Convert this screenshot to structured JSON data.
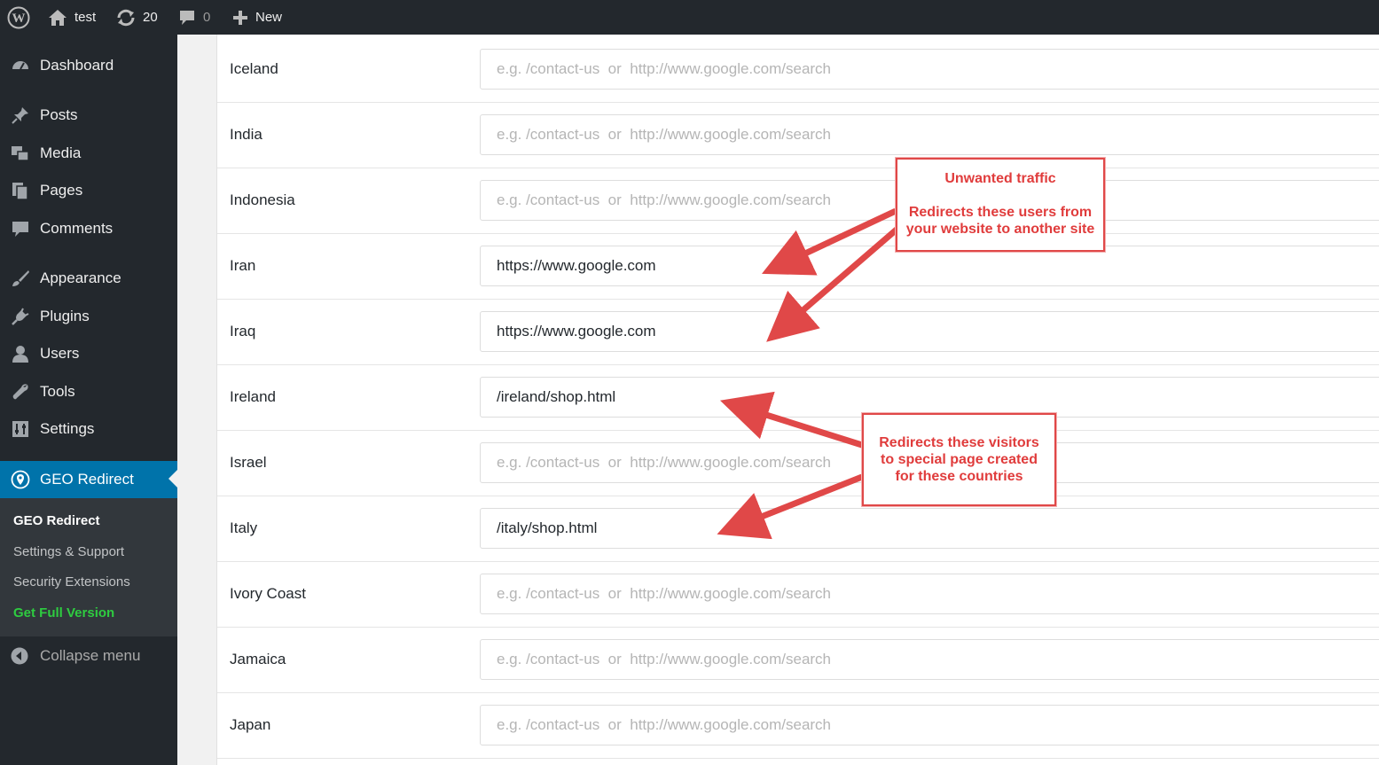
{
  "adminbar": {
    "site_name": "test",
    "updates_count": "20",
    "comments_count": "0",
    "new_label": "New"
  },
  "sidebar": {
    "items": [
      {
        "label": "Dashboard",
        "icon": "dashboard-icon"
      },
      {
        "label": "Posts",
        "icon": "pin-icon"
      },
      {
        "label": "Media",
        "icon": "media-icon"
      },
      {
        "label": "Pages",
        "icon": "pages-icon"
      },
      {
        "label": "Comments",
        "icon": "comment-icon"
      },
      {
        "label": "Appearance",
        "icon": "brush-icon"
      },
      {
        "label": "Plugins",
        "icon": "plug-icon"
      },
      {
        "label": "Users",
        "icon": "user-icon"
      },
      {
        "label": "Tools",
        "icon": "wrench-icon"
      },
      {
        "label": "Settings",
        "icon": "settings-icon"
      },
      {
        "label": "GEO Redirect",
        "icon": "location-pin-icon"
      }
    ],
    "submenu": [
      {
        "label": "GEO Redirect"
      },
      {
        "label": "Settings & Support"
      },
      {
        "label": "Security Extensions"
      },
      {
        "label": "Get Full Version"
      }
    ],
    "collapse_label": "Collapse menu",
    "active_color": "#0073aa",
    "promo_color": "#2ecc40"
  },
  "redirects": {
    "placeholder": "e.g. /contact-us  or  http://www.google.com/search",
    "rows": [
      {
        "country": "Iceland",
        "value": ""
      },
      {
        "country": "India",
        "value": ""
      },
      {
        "country": "Indonesia",
        "value": ""
      },
      {
        "country": "Iran",
        "value": "https://www.google.com"
      },
      {
        "country": "Iraq",
        "value": "https://www.google.com"
      },
      {
        "country": "Ireland",
        "value": "/ireland/shop.html"
      },
      {
        "country": "Israel",
        "value": ""
      },
      {
        "country": "Italy",
        "value": "/italy/shop.html"
      },
      {
        "country": "Ivory Coast",
        "value": ""
      },
      {
        "country": "Jamaica",
        "value": ""
      },
      {
        "country": "Japan",
        "value": ""
      }
    ]
  },
  "annotations": {
    "callout1": {
      "title": "Unwanted traffic",
      "line1": "Redirects these users from",
      "line2": "your website to another site"
    },
    "callout2": {
      "line1": "Redirects these visitors",
      "line2": "to special page created",
      "line3": "for these countries"
    },
    "color": "#e04848"
  }
}
